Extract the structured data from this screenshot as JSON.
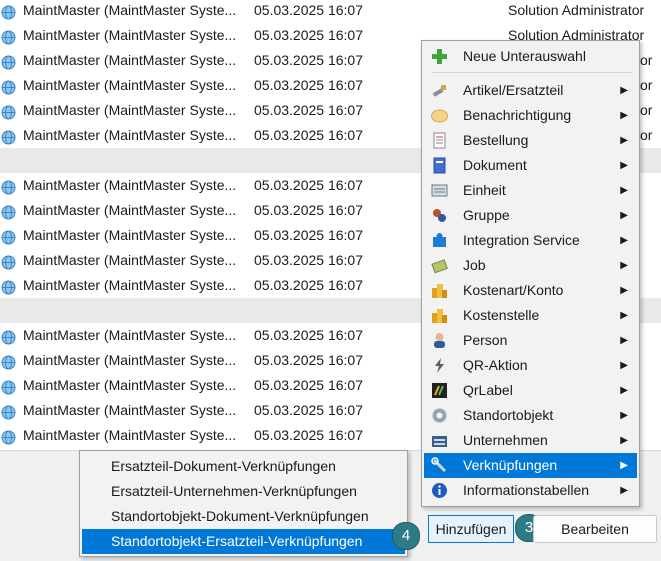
{
  "rows": [
    {
      "name": "MaintMaster (MaintMaster Syste...",
      "date": "05.03.2025 16:07",
      "user": "Solution Administrator"
    },
    {
      "name": "MaintMaster (MaintMaster Syste...",
      "date": "05.03.2025 16:07",
      "user": "Solution Administrator"
    },
    {
      "name": "MaintMaster (MaintMaster Syste...",
      "date": "05.03.2025 16:07",
      "user": "or"
    },
    {
      "name": "MaintMaster (MaintMaster Syste...",
      "date": "05.03.2025 16:07",
      "user": "or"
    },
    {
      "name": "MaintMaster (MaintMaster Syste...",
      "date": "05.03.2025 16:07",
      "user": "or"
    },
    {
      "name": "MaintMaster (MaintMaster Syste...",
      "date": "05.03.2025 16:07",
      "user": "or"
    },
    {
      "name": "MaintMaster (MaintMaster Syste...",
      "date": "05.03.2025 16:07",
      "user": ""
    },
    {
      "name": "MaintMaster (MaintMaster Syste...",
      "date": "05.03.2025 16:07",
      "user": ""
    },
    {
      "name": "MaintMaster (MaintMaster Syste...",
      "date": "05.03.2025 16:07",
      "user": ""
    },
    {
      "name": "MaintMaster (MaintMaster Syste...",
      "date": "05.03.2025 16:07",
      "user": ""
    },
    {
      "name": "MaintMaster (MaintMaster Syste...",
      "date": "05.03.2025 16:07",
      "user": ""
    },
    {
      "name": "MaintMaster (MaintMaster Syste...",
      "date": "05.03.2025 16:07",
      "user": ""
    },
    {
      "name": "MaintMaster (MaintMaster Syste...",
      "date": "05.03.2025 16:07",
      "user": ""
    },
    {
      "name": "MaintMaster (MaintMaster Syste...",
      "date": "05.03.2025 16:07",
      "user": ""
    },
    {
      "name": "MaintMaster (MaintMaster Syste...",
      "date": "05.03.2025 16:07",
      "user": ""
    },
    {
      "name": "MaintMaster (MaintMaster Syste...",
      "date": "05.03.2025 16:07",
      "user": ""
    }
  ],
  "menu": {
    "new_sub": "Neue Unterauswahl",
    "items": [
      {
        "label": "Artikel/Ersatzteil",
        "icon": "wrench-icon"
      },
      {
        "label": "Benachrichtigung",
        "icon": "notification-icon"
      },
      {
        "label": "Bestellung",
        "icon": "order-icon"
      },
      {
        "label": "Dokument",
        "icon": "document-icon"
      },
      {
        "label": "Einheit",
        "icon": "unit-icon"
      },
      {
        "label": "Gruppe",
        "icon": "group-icon"
      },
      {
        "label": "Integration Service",
        "icon": "puzzle-icon"
      },
      {
        "label": "Job",
        "icon": "job-icon"
      },
      {
        "label": "Kostenart/Konto",
        "icon": "coins-icon"
      },
      {
        "label": "Kostenstelle",
        "icon": "coins-icon"
      },
      {
        "label": "Person",
        "icon": "person-icon"
      },
      {
        "label": "QR-Aktion",
        "icon": "lightning-icon"
      },
      {
        "label": "QrLabel",
        "icon": "label-icon"
      },
      {
        "label": "Standortobjekt",
        "icon": "gear-icon"
      },
      {
        "label": "Unternehmen",
        "icon": "company-icon"
      },
      {
        "label": "Verknüpfungen",
        "icon": "link-icon"
      },
      {
        "label": "Informationstabellen",
        "icon": "info-icon"
      }
    ]
  },
  "submenu": {
    "items": [
      "Ersatzteil-Dokument-Verknüpfungen",
      "Ersatzteil-Unternehmen-Verknüpfungen",
      "Standortobjekt-Dokument-Verknüpfungen",
      "Standortobjekt-Ersatzteil-Verknüpfungen"
    ]
  },
  "buttons": {
    "add": "Hinzufügen",
    "edit": "Bearbeiten"
  },
  "badges": {
    "step3": "3",
    "step4": "4"
  },
  "colors": {
    "highlight": "#0078d7",
    "badge": "#2d7b84"
  }
}
